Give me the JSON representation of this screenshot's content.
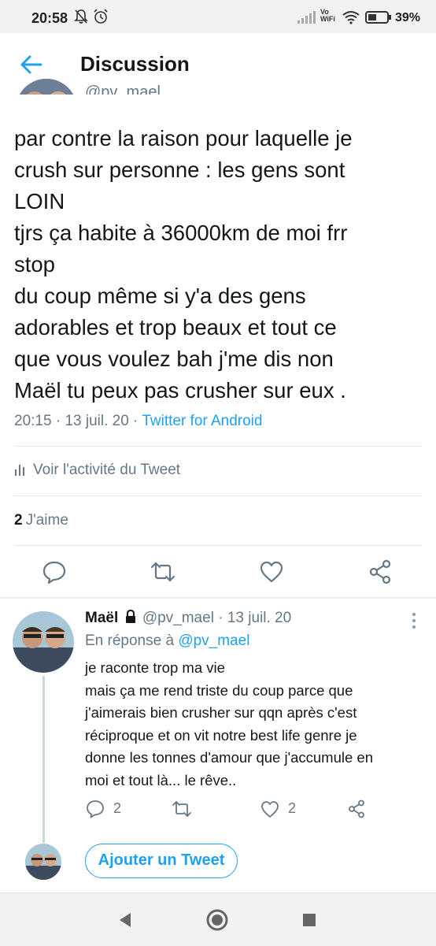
{
  "status_bar": {
    "time": "20:58",
    "vowifi_top": "Vo",
    "vowifi_bottom": "WiFi",
    "battery_percent": "39%"
  },
  "header": {
    "title": "Discussion",
    "partial_handle": "@pv_mael"
  },
  "tweet": {
    "text": "par contre la raison pour laquelle je\ncrush sur personne : les gens sont\nLOIN\ntjrs ça habite à 36000km de moi frr\nstop\ndu coup même si y'a des gens\nadorables et trop beaux et tout ce\nque vous voulez bah j'me dis non\nMaël tu peux pas crusher sur eux .",
    "time": "20:15",
    "dot1": " · ",
    "date": "13 juil. 20",
    "dot2": " · ",
    "source": "Twitter for Android",
    "activity_label": "Voir l'activité du Tweet",
    "likes_count": "2",
    "likes_label": "J'aime"
  },
  "reply": {
    "name": "Maël",
    "handle": "@pv_mael",
    "dot": " · ",
    "date": "13 juil. 20",
    "reply_prefix": "En réponse à ",
    "reply_mention": "@pv_mael",
    "text": "je raconte trop ma vie\nmais ça me rend triste du coup parce que\nj'aimerais bien crusher sur qqn après c'est\nréciproque et on vit notre best life genre je\ndonne les tonnes d'amour que j'accumule en\nmoi et tout là... le rêve..",
    "reply_count": "2",
    "like_count": "2"
  },
  "compose": {
    "button_label": "Ajouter un Tweet"
  },
  "icons": {
    "back": "arrow-left-icon",
    "reply": "comment-icon",
    "retweet": "retweet-icon",
    "like": "heart-icon",
    "share": "share-icon",
    "lock": "lock-icon",
    "more": "more-vertical-icon"
  },
  "colors": {
    "accent": "#1da1f2",
    "secondary_text": "#657786",
    "primary_text": "#14171a"
  }
}
